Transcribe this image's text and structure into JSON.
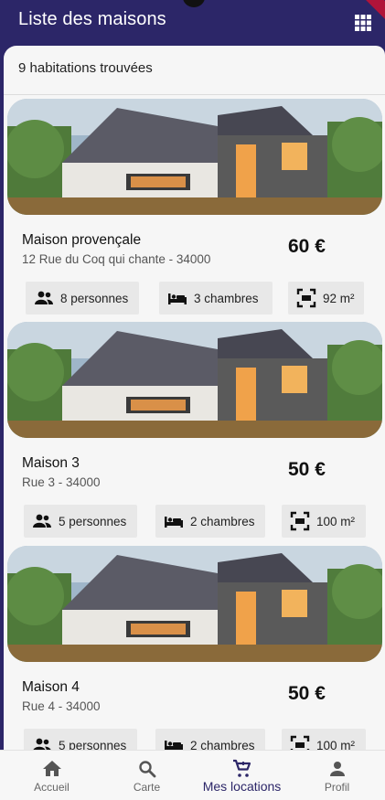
{
  "appbar": {
    "title": "Liste des maisons",
    "grid_icon": "grid-view-icon"
  },
  "results": {
    "count_label": "9 habitations trouvées"
  },
  "listings": [
    {
      "name": "Maison provençale",
      "address": "12 Rue du Coq qui chante - 34000",
      "price": "60 €",
      "persons": "8 personnes",
      "rooms": "3 chambres",
      "area": "92 m²"
    },
    {
      "name": "Maison 3",
      "address": "Rue 3 - 34000",
      "price": "50 €",
      "persons": "5 personnes",
      "rooms": "2 chambres",
      "area": "100 m²"
    },
    {
      "name": "Maison 4",
      "address": "Rue 4 - 34000",
      "price": "50 €",
      "persons": "5 personnes",
      "rooms": "2 chambres",
      "area": "100 m²"
    }
  ],
  "bottom_nav": [
    {
      "label": "Accueil",
      "icon": "home-icon"
    },
    {
      "label": "Carte",
      "icon": "search-icon"
    },
    {
      "label": "Mes locations",
      "icon": "cart-icon",
      "active": true
    },
    {
      "label": "Profil",
      "icon": "person-icon"
    }
  ],
  "colors": {
    "primary": "#2c2668",
    "chip_bg": "#e8e8e8",
    "background": "#f6f6f6"
  }
}
